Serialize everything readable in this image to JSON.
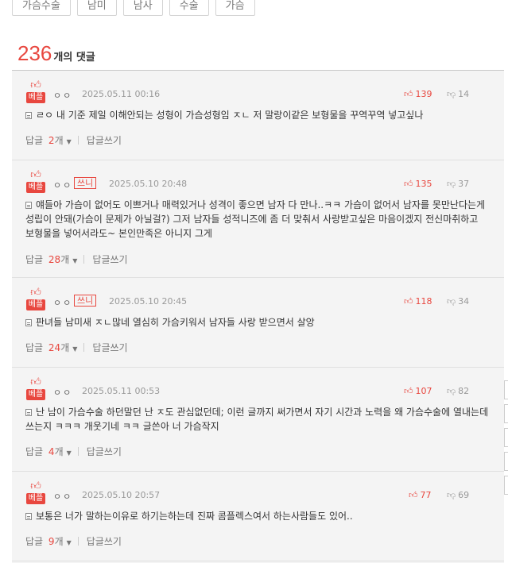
{
  "tags": [
    "가슴수술",
    "남미",
    "남사",
    "수술",
    "가슴"
  ],
  "comment_count": "236",
  "comment_count_label": "개의 댓글",
  "best_label": "베플",
  "thumb_icon": "thumbs-up-icon",
  "ssni_label": "쓰니",
  "reply_label": "답글",
  "reply_unit": "개",
  "write_reply_label": "답글쓰기",
  "comments": [
    {
      "author": "ㅇㅇ",
      "date": "2025.05.11 00:16",
      "likes": "139",
      "dislikes": "14",
      "text": "ㄹㅇ 내 기준 제일 이해안되는 성형이 가슴성형임 ㅈㄴ 저 말랑이같은 보형물을 꾸역꾸역 넣고싶나",
      "replies": "2"
    },
    {
      "author": "ㅇㅇ",
      "date": "2025.05.10 20:48",
      "likes": "135",
      "dislikes": "37",
      "text": "얘들아 가슴이 없어도 이쁘거나 매력있거나 성격이 좋으면 남자 다 만나..ㅋㅋ 가슴이 없어서 남자를 못만난다는게 성립이 안돼(가슴이 문제가 아닐걸?) 그저 남자들 성적니즈에 좀 더 맞춰서 사랑받고싶은 마음이겠지 전신마취하고 보형물을 넣어서라도~ 본인만족은 아니지 그게",
      "replies": "28"
    },
    {
      "author": "ㅇㅇ",
      "date": "2025.05.10 20:45",
      "likes": "118",
      "dislikes": "34",
      "text": "판녀들 남미새 ㅈㄴ많네 열심히 가슴키워서 남자들 사랑 받으면서 살앙",
      "replies": "24"
    },
    {
      "author": "ㅇㅇ",
      "date": "2025.05.11 00:53",
      "likes": "107",
      "dislikes": "82",
      "text": "난 남이 가슴수술 하던말던 난 ㅈ도 관심없던데; 이런 글까지 써가면서 자기 시간과 노력을 왜 가슴수술에 열내는데 쓰는지 ㅋㅋㅋ 개웃기네 ㅋㅋ 글쓴아 너 가슴작지",
      "replies": "4"
    },
    {
      "author": "ㅇㅇ",
      "date": "2025.05.10 20:57",
      "likes": "77",
      "dislikes": "69",
      "text": "보통은 너가 말하는이유로 하기는하는데 진짜 콤플렉스여서 하는사람들도 있어..",
      "replies": "9"
    }
  ]
}
